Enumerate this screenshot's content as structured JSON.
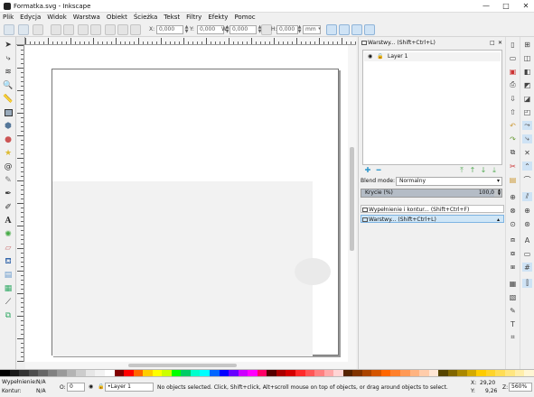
{
  "window": {
    "title": "Formatka.svg - Inkscape",
    "minimize": "—",
    "maximize": "□",
    "close": "✕"
  },
  "menu": [
    "Plik",
    "Edycja",
    "Widok",
    "Warstwa",
    "Obiekt",
    "Ścieżka",
    "Tekst",
    "Filtry",
    "Efekty",
    "Pomoc"
  ],
  "toolbar": {
    "x_label": "X:",
    "x_value": "0,000",
    "y_label": "Y:",
    "y_value": "0,000",
    "w_label": "W:",
    "w_value": "0,000",
    "h_label": "H:",
    "h_value": "0,000",
    "unit": "mm"
  },
  "tools": [
    "selector-tool-icon",
    "node-tool-icon",
    "tweak-tool-icon",
    "zoom-tool-icon",
    "measure-tool-icon",
    "rectangle-tool-icon",
    "box3d-tool-icon",
    "ellipse-tool-icon",
    "star-tool-icon",
    "spiral-tool-icon",
    "pencil-tool-icon",
    "pen-tool-icon",
    "calligraphy-tool-icon",
    "text-tool-icon",
    "spray-tool-icon",
    "eraser-tool-icon",
    "paint-bucket-tool-icon",
    "gradient-tool-icon",
    "mesh-tool-icon",
    "dropper-tool-icon",
    "connector-tool-icon"
  ],
  "layers_panel": {
    "title": "Warstwy... (Shift+Ctrl+L)",
    "layer_name": "Layer 1",
    "blend_label": "Blend mode:",
    "blend_value": "Normalny",
    "opacity_label": "Krycie (%)",
    "opacity_value": "100,0",
    "opacity_fraction": 1.0
  },
  "docked_tabs": [
    {
      "label": "Wypełnienie i kontur... (Shift+Ctrl+F)"
    },
    {
      "label": "Warstwy... (Shift+Ctrl+L)"
    }
  ],
  "status": {
    "fill_label": "Wypełnienie:",
    "stroke_label": "Kontur:",
    "fill_value": "N/A",
    "stroke_value": "N/A",
    "opacity_label": "O:",
    "opacity_value": "0",
    "layer_select": "•Layer 1",
    "message": "No objects selected. Click, Shift+click, Alt+scroll mouse on top of objects, or drag around objects to select.",
    "x_label": "X:",
    "x_value": "29,20",
    "y_label": "Y:",
    "y_value": "9,26",
    "z_label": "Z:",
    "zoom_value": "560%"
  },
  "palette_colors": [
    "#000000",
    "#1a1a1a",
    "#333333",
    "#4d4d4d",
    "#666666",
    "#808080",
    "#999999",
    "#b3b3b3",
    "#cccccc",
    "#e6e6e6",
    "#f2f2f2",
    "#ffffff",
    "#800000",
    "#ff0000",
    "#ff6600",
    "#ffcc00",
    "#ffff00",
    "#ccff00",
    "#00ff00",
    "#00cc66",
    "#00ffcc",
    "#00ffff",
    "#0066ff",
    "#0000ff",
    "#6600ff",
    "#cc00ff",
    "#ff00ff",
    "#ff0066",
    "#550000",
    "#aa0000",
    "#d40000",
    "#ff2a2a",
    "#ff5555",
    "#ff8080",
    "#ffaaaa",
    "#ffd5d5",
    "#552200",
    "#803300",
    "#aa4400",
    "#d45500",
    "#ff6600",
    "#ff7f2a",
    "#ff9955",
    "#ffb380",
    "#ffccaa",
    "#ffe6d5",
    "#554400",
    "#806600",
    "#aa8800",
    "#d4aa00",
    "#ffcc00",
    "#ffd42a",
    "#ffdd55",
    "#ffe680",
    "#ffeeaa",
    "#fff6d5"
  ]
}
